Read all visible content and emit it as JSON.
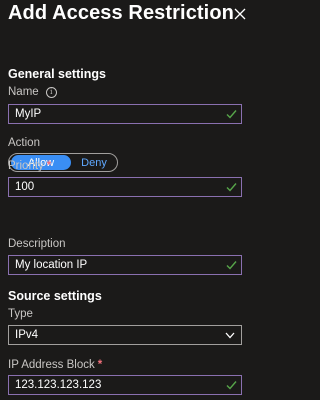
{
  "panel": {
    "title": "Add Access Restriction"
  },
  "general": {
    "heading": "General settings",
    "name_label": "Name",
    "name_value": "MyIP",
    "action_label": "Action",
    "action_options": [
      "Allow",
      "Deny"
    ],
    "action_selected": "Allow",
    "priority_label": "Priority",
    "priority_value": "100",
    "description_label": "Description",
    "description_value": "My location IP"
  },
  "source": {
    "heading": "Source settings",
    "type_label": "Type",
    "type_value": "IPv4",
    "ip_label": "IP Address Block",
    "ip_value": "123.123.123.123"
  },
  "colors": {
    "background": "#1b1a19",
    "accent": "#3a8ef4",
    "field_border": "#8a70b0",
    "valid_check": "#57a64a",
    "required": "#f1707b"
  },
  "icons": [
    "close-icon",
    "info-icon",
    "checkmark-icon",
    "chevron-down-icon"
  ]
}
